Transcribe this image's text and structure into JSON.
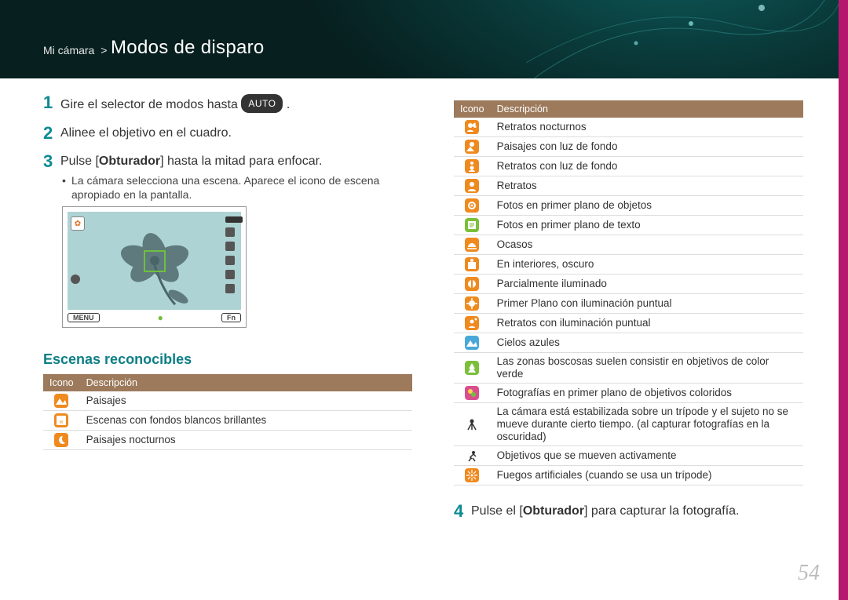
{
  "breadcrumb": {
    "parent": "Mi cámara",
    "title": "Modos de disparo"
  },
  "steps": {
    "s1_pre": "Gire el selector de modos hasta ",
    "s1_pill": "AUTO",
    "s1_post": " .",
    "s2": "Alinee el objetivo en el cuadro.",
    "s3_pre": "Pulse [",
    "s3_bold": "Obturador",
    "s3_post": "] hasta la mitad para enfocar.",
    "s3_bullet": "La cámara selecciona una escena. Aparece el icono de escena apropiado en la pantalla.",
    "s4_pre": "Pulse el [",
    "s4_bold": "Obturador",
    "s4_post": "] para capturar la fotografía."
  },
  "screen": {
    "menu": "MENU",
    "fn": "Fn"
  },
  "section_heading": "Escenas reconocibles",
  "table_headers": {
    "col1": "Icono",
    "col2": "Descripción"
  },
  "left_rows": [
    {
      "icon": "landscape-icon",
      "color": "#ef8a1f",
      "desc": "Paisajes"
    },
    {
      "icon": "white-scene-icon",
      "color": "#ef8a1f",
      "desc": "Escenas con fondos blancos brillantes"
    },
    {
      "icon": "night-landscape-icon",
      "color": "#ef8a1f",
      "desc": "Paisajes nocturnos"
    }
  ],
  "right_rows": [
    {
      "icon": "night-portrait-icon",
      "color": "#ef8a1f",
      "desc": "Retratos nocturnos"
    },
    {
      "icon": "backlight-landscape-icon",
      "color": "#ef8a1f",
      "desc": "Paisajes con luz de fondo"
    },
    {
      "icon": "backlight-portrait-icon",
      "color": "#ef8a1f",
      "desc": "Retratos con luz de fondo"
    },
    {
      "icon": "portrait-icon",
      "color": "#ef8a1f",
      "desc": "Retratos"
    },
    {
      "icon": "macro-object-icon",
      "color": "#ef8a1f",
      "desc": "Fotos en primer plano de objetos"
    },
    {
      "icon": "macro-text-icon",
      "color": "#7bbf3b",
      "desc": "Fotos en primer plano de texto"
    },
    {
      "icon": "sunset-icon",
      "color": "#ef8a1f",
      "desc": "Ocasos"
    },
    {
      "icon": "indoor-dark-icon",
      "color": "#ef8a1f",
      "desc": "En interiores, oscuro"
    },
    {
      "icon": "partial-light-icon",
      "color": "#ef8a1f",
      "desc": "Parcialmente iluminado"
    },
    {
      "icon": "spot-macro-icon",
      "color": "#ef8a1f",
      "desc": "Primer Plano con iluminación puntual"
    },
    {
      "icon": "spot-portrait-icon",
      "color": "#ef8a1f",
      "desc": "Retratos con iluminación puntual"
    },
    {
      "icon": "blue-sky-icon",
      "color": "#4aa8d8",
      "desc": "Cielos azules"
    },
    {
      "icon": "green-nature-icon",
      "color": "#7bbf3b",
      "desc": "Las zonas boscosas suelen consistir en objetivos de color verde"
    },
    {
      "icon": "macro-color-icon",
      "color": "#d94f8e",
      "desc": "Fotografías en primer plano de objetivos coloridos"
    },
    {
      "icon": "tripod-icon",
      "color": "#333333",
      "desc": "La cámara está estabilizada sobre un trípode y el sujeto no se mueve durante cierto tiempo. (al capturar fotografías en la oscuridad)"
    },
    {
      "icon": "action-icon",
      "color": "#333333",
      "desc": "Objetivos que se mueven activamente"
    },
    {
      "icon": "fireworks-icon",
      "color": "#ef8a1f",
      "desc": "Fuegos artificiales (cuando se usa un trípode)"
    }
  ],
  "page_number": "54"
}
